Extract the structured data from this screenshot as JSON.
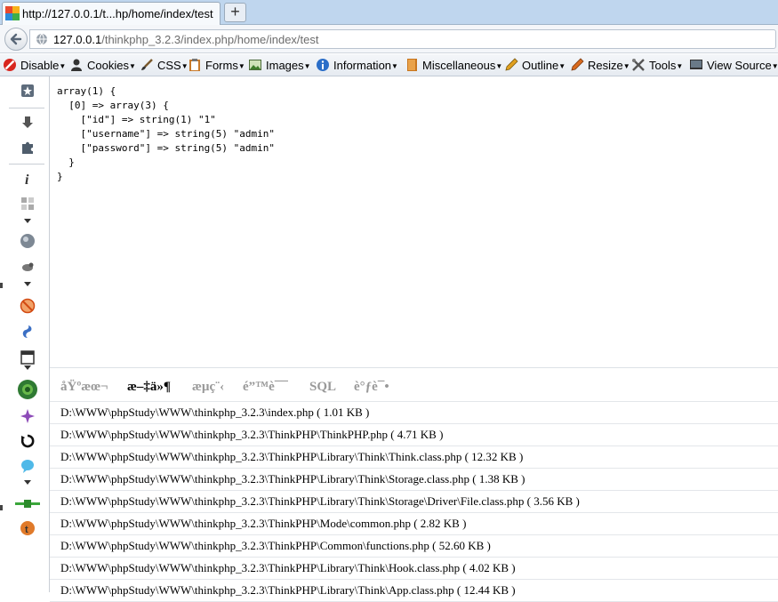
{
  "browser": {
    "tab_title": "http://127.0.0.1/t...hp/home/index/test",
    "url_host": "127.0.0.1",
    "url_path": "/thinkphp_3.2.3/index.php/home/index/test"
  },
  "toolbar": {
    "items": [
      "Disable",
      "Cookies",
      "CSS",
      "Forms",
      "Images",
      "Information",
      "Miscellaneous",
      "Outline",
      "Resize",
      "Tools",
      "View Source"
    ]
  },
  "dump": {
    "lines": [
      "array(1) {",
      "  [0] => array(3) {",
      "    [\"id\"] => string(1) \"1\"",
      "    [\"username\"] => string(5) \"admin\"",
      "    [\"password\"] => string(5) \"admin\"",
      "  }",
      "}"
    ]
  },
  "trace": {
    "tabs": [
      "åŸºæœ¬",
      "æ–‡ä»¶",
      "æµç¨‹",
      "é”™è¯¯",
      "SQL",
      "è°ƒè¯•"
    ],
    "files": [
      "D:\\WWW\\phpStudy\\WWW\\thinkphp_3.2.3\\index.php ( 1.01 KB )",
      "D:\\WWW\\phpStudy\\WWW\\thinkphp_3.2.3\\ThinkPHP\\ThinkPHP.php ( 4.71 KB )",
      "D:\\WWW\\phpStudy\\WWW\\thinkphp_3.2.3\\ThinkPHP\\Library\\Think\\Think.class.php ( 12.32 KB )",
      "D:\\WWW\\phpStudy\\WWW\\thinkphp_3.2.3\\ThinkPHP\\Library\\Think\\Storage.class.php ( 1.38 KB )",
      "D:\\WWW\\phpStudy\\WWW\\thinkphp_3.2.3\\ThinkPHP\\Library\\Think\\Storage\\Driver\\File.class.php ( 3.56 KB )",
      "D:\\WWW\\phpStudy\\WWW\\thinkphp_3.2.3\\ThinkPHP\\Mode\\common.php ( 2.82 KB )",
      "D:\\WWW\\phpStudy\\WWW\\thinkphp_3.2.3\\ThinkPHP\\Common\\functions.php ( 52.60 KB )",
      "D:\\WWW\\phpStudy\\WWW\\thinkphp_3.2.3\\ThinkPHP\\Library\\Think\\Hook.class.php ( 4.02 KB )",
      "D:\\WWW\\phpStudy\\WWW\\thinkphp_3.2.3\\ThinkPHP\\Library\\Think\\App.class.php ( 12.44 KB )"
    ]
  }
}
